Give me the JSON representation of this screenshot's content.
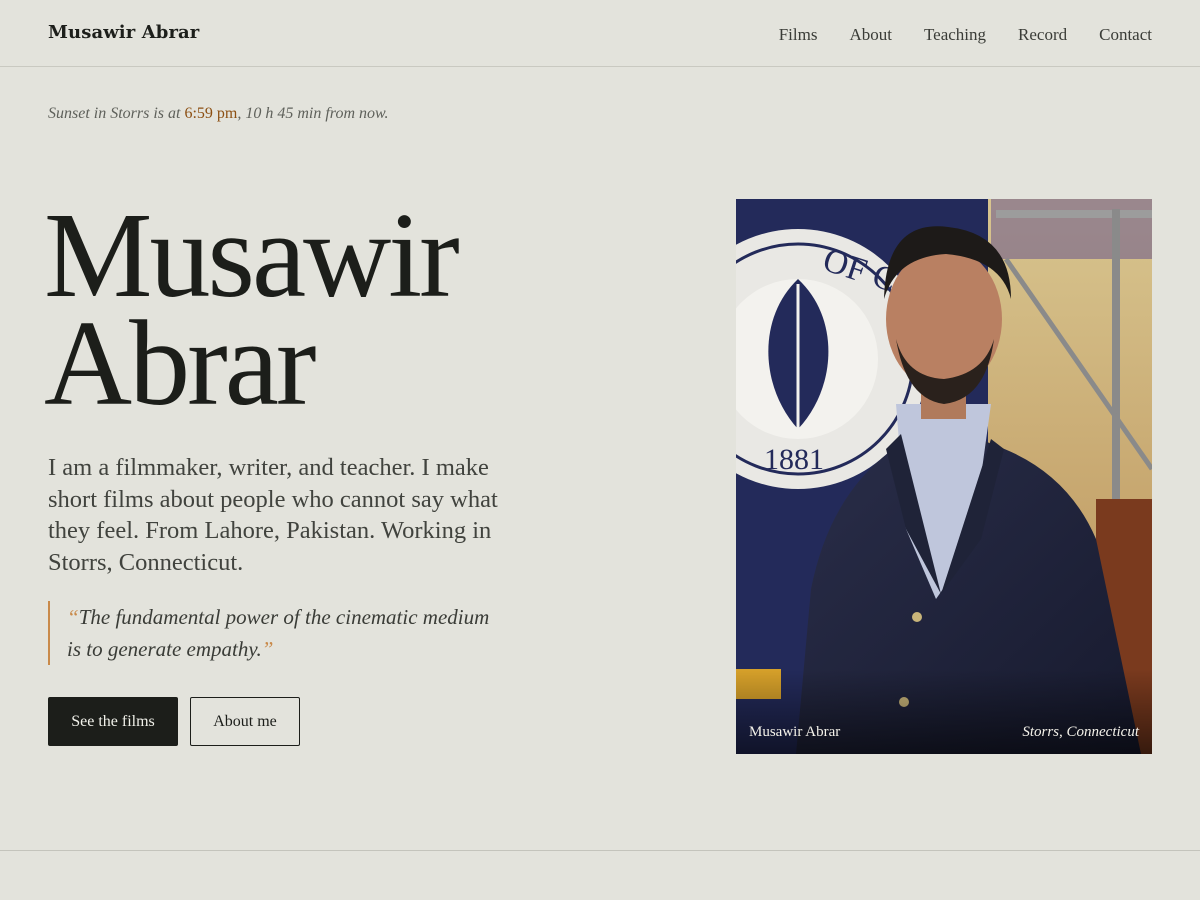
{
  "header": {
    "brand": "Musawir Abrar",
    "nav": [
      "Films",
      "About",
      "Teaching",
      "Record",
      "Contact"
    ]
  },
  "sunset": {
    "prefix": "Sunset in Storrs is at ",
    "time": "6:59 pm",
    "suffix": ", 10 h 45 min from now."
  },
  "hero": {
    "title_line1": "Musawir",
    "title_line2": "Abrar",
    "intro": "I am a filmmaker, writer, and teacher. I make short films about people who cannot say what they feel. From Lahore, Pakistan. Working in Storrs, Connecticut.",
    "quote": "The fundamental power of the cinematic medium is to generate empathy.",
    "quote_open": "“",
    "quote_close": "”",
    "primary_button": "See the films",
    "secondary_button": "About me"
  },
  "photo": {
    "caption_name": "Musawir Abrar",
    "caption_place": "Storrs, Connecticut",
    "banner_text": "OF CONN",
    "seal_year": "1881"
  },
  "colors": {
    "background": "#e3e3dc",
    "accent": "#c98a4a",
    "time_highlight": "#8c4f12",
    "primary_button": "#1c1e1a"
  }
}
